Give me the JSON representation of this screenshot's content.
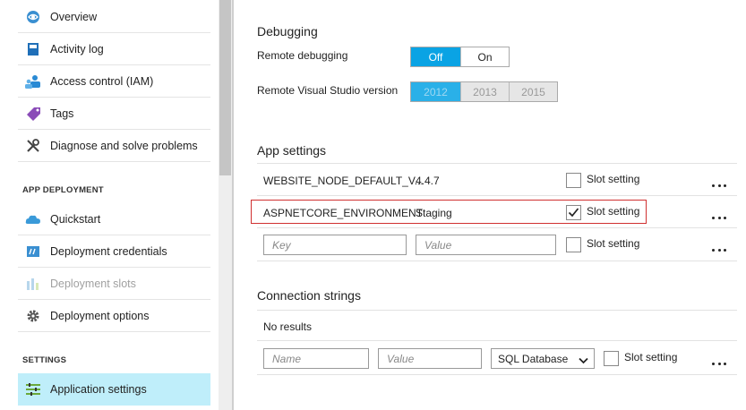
{
  "sidebar": {
    "items": [
      {
        "label": "Overview",
        "icon": "globe-icon"
      },
      {
        "label": "Activity log",
        "icon": "book-icon"
      },
      {
        "label": "Access control (IAM)",
        "icon": "users-icon"
      },
      {
        "label": "Tags",
        "icon": "tag-icon"
      },
      {
        "label": "Diagnose and solve problems",
        "icon": "wrench-icon"
      }
    ],
    "section_deployment": "APP DEPLOYMENT",
    "deployment_items": [
      {
        "label": "Quickstart",
        "icon": "cloud-icon"
      },
      {
        "label": "Deployment credentials",
        "icon": "credentials-icon"
      },
      {
        "label": "Deployment slots",
        "icon": "slots-icon"
      },
      {
        "label": "Deployment options",
        "icon": "gear-icon"
      }
    ],
    "section_settings": "SETTINGS",
    "settings_items": [
      {
        "label": "Application settings",
        "icon": "list-settings-icon"
      }
    ]
  },
  "debugging": {
    "title": "Debugging",
    "remote_debugging_label": "Remote debugging",
    "remote_debugging_options": [
      "Off",
      "On"
    ],
    "remote_debugging_selected": "Off",
    "vs_version_label": "Remote Visual Studio version",
    "vs_version_options": [
      "2012",
      "2013",
      "2015"
    ],
    "vs_version_selected": "2012"
  },
  "app_settings": {
    "title": "App settings",
    "rows": [
      {
        "name": "WEBSITE_NODE_DEFAULT_V...",
        "value": "4.4.7",
        "slot_setting": false
      },
      {
        "name": "ASPNETCORE_ENVIRONMENT",
        "value": "Staging",
        "slot_setting": true
      }
    ],
    "slot_setting_label": "Slot setting",
    "new_key_placeholder": "Key",
    "new_value_placeholder": "Value"
  },
  "connection_strings": {
    "title": "Connection strings",
    "empty_text": "No results",
    "name_placeholder": "Name",
    "value_placeholder": "Value",
    "type_selected": "SQL Database",
    "slot_setting_label": "Slot setting"
  },
  "colors": {
    "accent": "#0aa3e4",
    "active_nav": "#bfeefa",
    "highlight_border": "#d03030"
  }
}
